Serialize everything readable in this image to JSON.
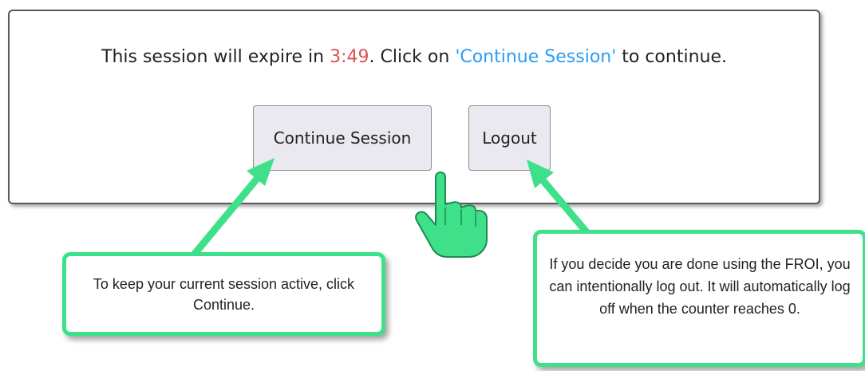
{
  "dialog": {
    "message_prefix": "This session will expire in ",
    "countdown": "3:49",
    "message_middle": ". Click on ",
    "continue_reference": "'Continue Session'",
    "message_suffix": " to continue.",
    "continue_button_label": "Continue Session",
    "logout_button_label": "Logout"
  },
  "annotations": {
    "continue_note": "To keep your current session active, click Continue.",
    "logout_note": "If you decide you are done using the FROI, you can intentionally log out.  It will automatically log off when the counter reaches 0."
  },
  "icons": {
    "arrow_left": "arrow-icon",
    "arrow_right": "arrow-icon",
    "cursor": "pointing-hand-icon"
  },
  "colors": {
    "countdown": "#d9534f",
    "continue_reference": "#2a9df4",
    "annotation_accent": "#3ee08a"
  }
}
